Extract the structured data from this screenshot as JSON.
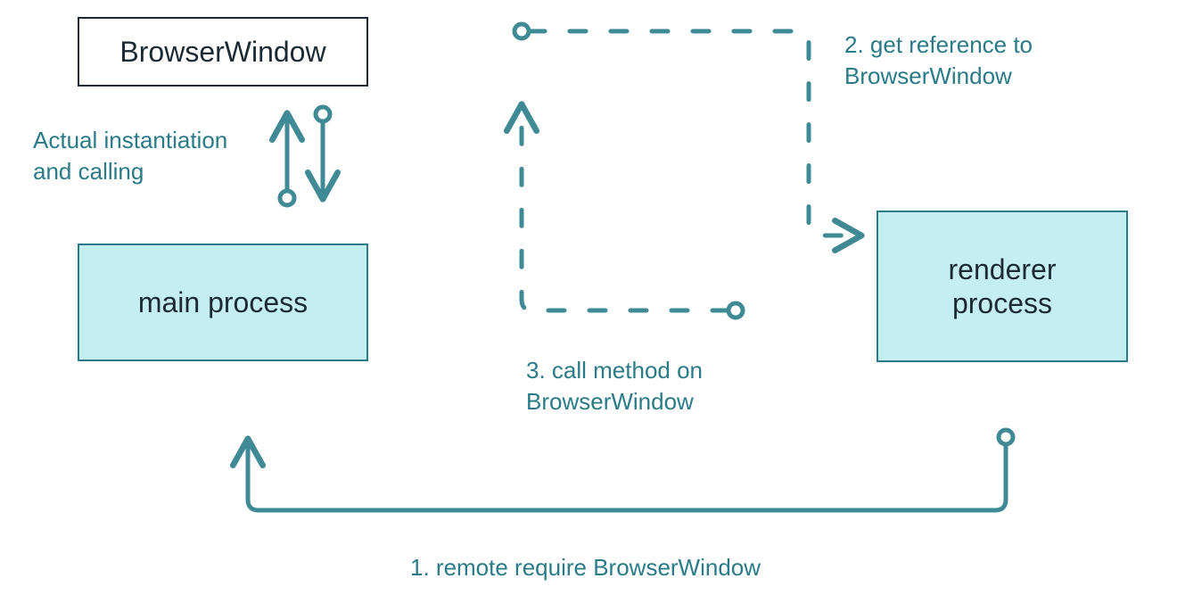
{
  "boxes": {
    "browser_window": "BrowserWindow",
    "main_process": "main process",
    "renderer_process": "renderer\nprocess"
  },
  "labels": {
    "actual": "Actual instantiation and calling",
    "step1": "1. remote require BrowserWindow",
    "step2": "2. get reference to BrowserWindow",
    "step3": "3. call method on BrowserWindow"
  },
  "colors": {
    "teal": "#3f8a94",
    "teal_dark": "#2a7b87",
    "box_fill": "#c5eef3",
    "text_dark": "#1b2a33"
  },
  "diagram": {
    "description": "Electron remote module flow: renderer process remotely requires BrowserWindow from main process, gets a reference, and calls methods on it; actual instantiation happens in main process.",
    "nodes": [
      {
        "id": "browser_window",
        "label": "BrowserWindow"
      },
      {
        "id": "main_process",
        "label": "main process"
      },
      {
        "id": "renderer_process",
        "label": "renderer process"
      }
    ],
    "edges": [
      {
        "from": "renderer_process",
        "to": "main_process",
        "label": "1. remote require BrowserWindow",
        "style": "solid"
      },
      {
        "from": "main_process",
        "to": "renderer_process",
        "via": "browser_window",
        "label": "2. get reference to BrowserWindow",
        "style": "dashed"
      },
      {
        "from": "renderer_process",
        "to": "browser_window",
        "label": "3. call method on BrowserWindow",
        "style": "dashed"
      },
      {
        "from": "main_process",
        "to": "browser_window",
        "label": "Actual instantiation and calling",
        "style": "solid",
        "bidirectional": true
      }
    ]
  }
}
